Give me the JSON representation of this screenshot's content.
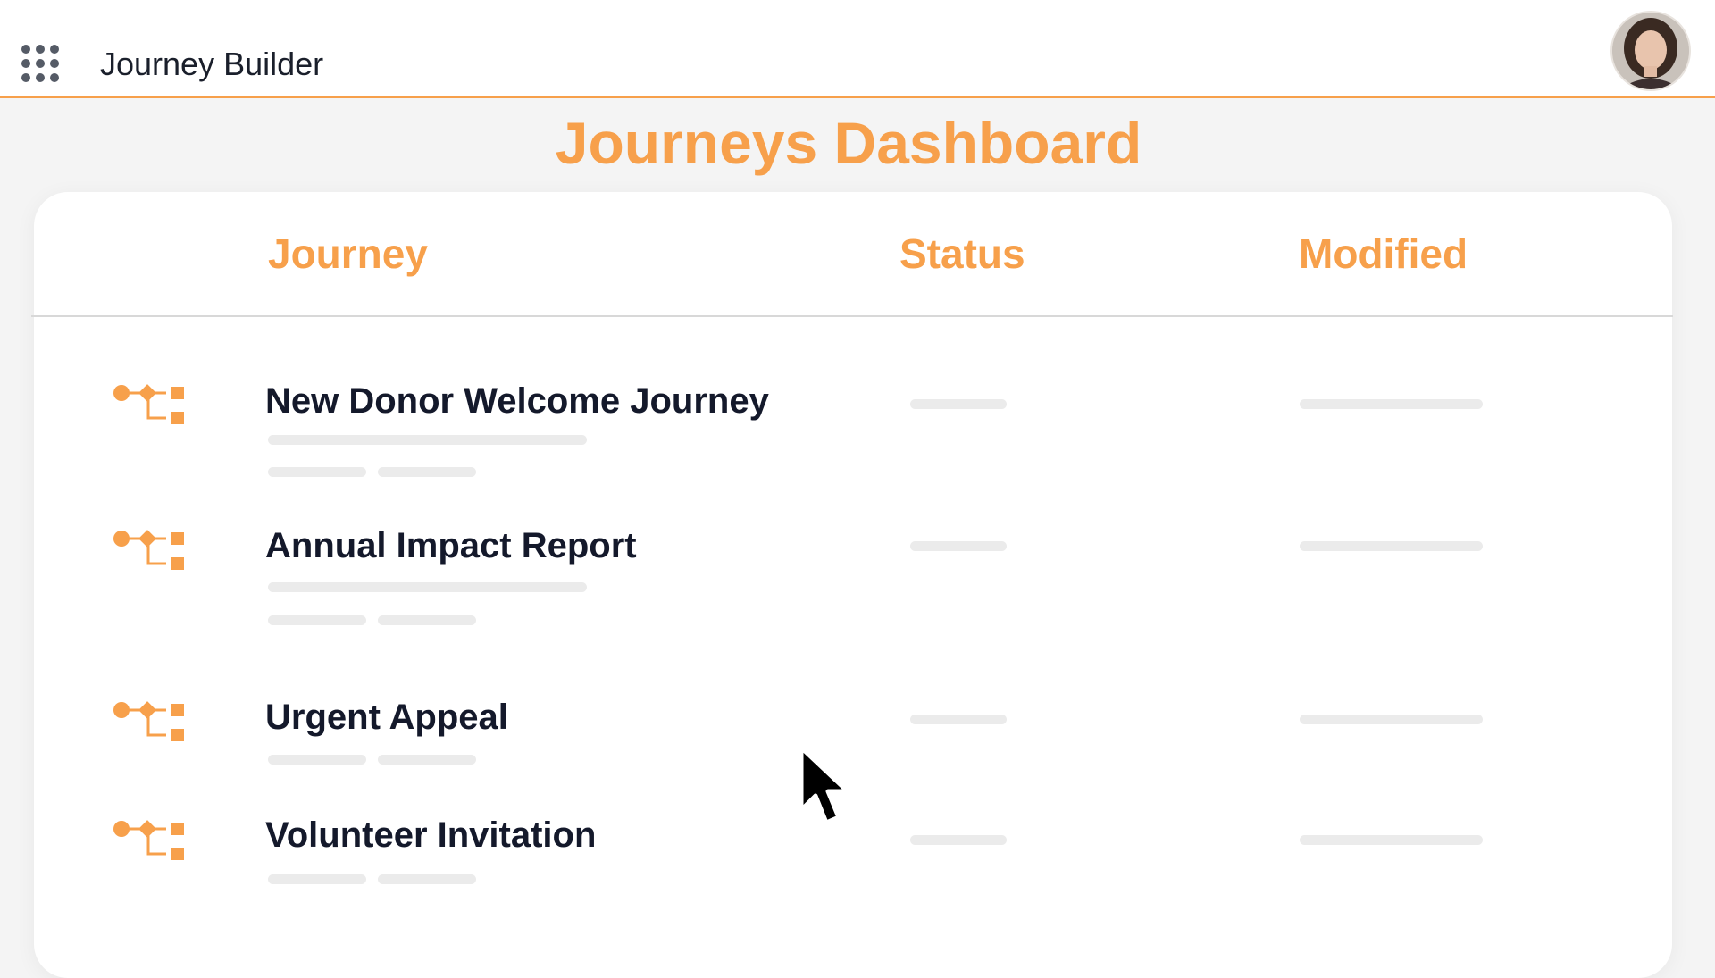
{
  "header": {
    "app_name": "Journey Builder",
    "app_launcher_icon": "grid-icon",
    "avatar_icon": "user-avatar"
  },
  "page": {
    "title": "Journeys Dashboard"
  },
  "table": {
    "columns": [
      "Journey",
      "Status",
      "Modified"
    ],
    "rows": [
      {
        "name": "New Donor Welcome Journey",
        "icon": "journey-flow-icon"
      },
      {
        "name": "Annual Impact Report",
        "icon": "journey-flow-icon"
      },
      {
        "name": "Urgent Appeal",
        "icon": "journey-flow-icon"
      },
      {
        "name": "Volunteer Invitation",
        "icon": "journey-flow-icon"
      }
    ]
  },
  "colors": {
    "accent": "#f7a04b",
    "text": "#14192b",
    "placeholder": "#ebebeb"
  }
}
